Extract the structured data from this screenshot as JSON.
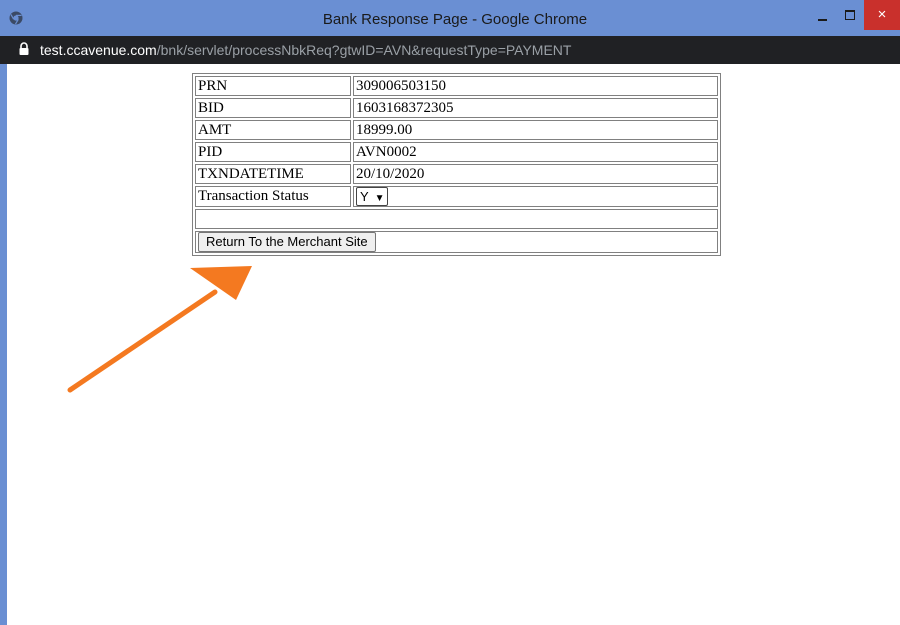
{
  "window": {
    "title": "Bank Response Page - Google Chrome",
    "close_glyph": "×"
  },
  "address": {
    "host": "test.ccavenue.com",
    "path": "/bnk/servlet/processNbkReq?gtwID=AVN&requestType=PAYMENT"
  },
  "response": {
    "rows": [
      {
        "label": "PRN",
        "value": "309006503150"
      },
      {
        "label": "BID",
        "value": "1603168372305"
      },
      {
        "label": "AMT",
        "value": "18999.00"
      },
      {
        "label": "PID",
        "value": "AVN0002"
      },
      {
        "label": "TXNDATETIME",
        "value": "20/10/2020"
      }
    ],
    "status_label": "Transaction Status",
    "status_value": "Y",
    "return_button": "Return To the Merchant Site"
  },
  "annotation": {
    "arrow_color": "#f47920"
  },
  "colors": {
    "titlebar": "#6a8fd3",
    "close": "#c9302c",
    "addressbar": "#202124"
  }
}
